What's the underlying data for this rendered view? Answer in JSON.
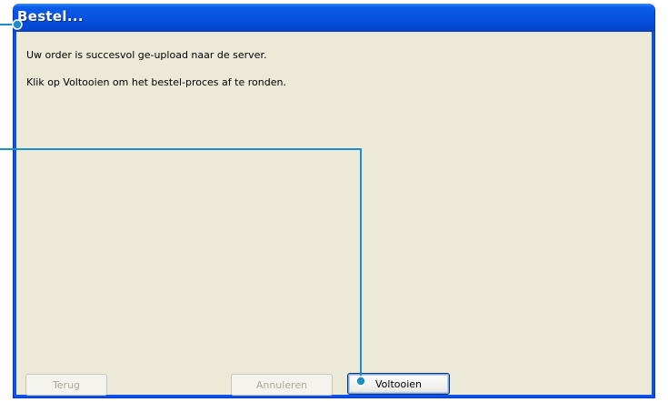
{
  "window": {
    "title": "Bestel..."
  },
  "messages": {
    "line1": "Uw order is succesvol ge-upload naar de server.",
    "line2": "Klik op Voltooien om het bestel-proces af te ronden."
  },
  "buttons": {
    "back": {
      "label": "Terug",
      "enabled": false
    },
    "cancel": {
      "label": "Annuleren",
      "enabled": false
    },
    "finish": {
      "label": "Voltooien",
      "enabled": true,
      "default": true
    }
  },
  "colors": {
    "titlebar": "#0653e0",
    "dialog_background": "#ece9d8",
    "callout_line": "#1b8fc9"
  }
}
